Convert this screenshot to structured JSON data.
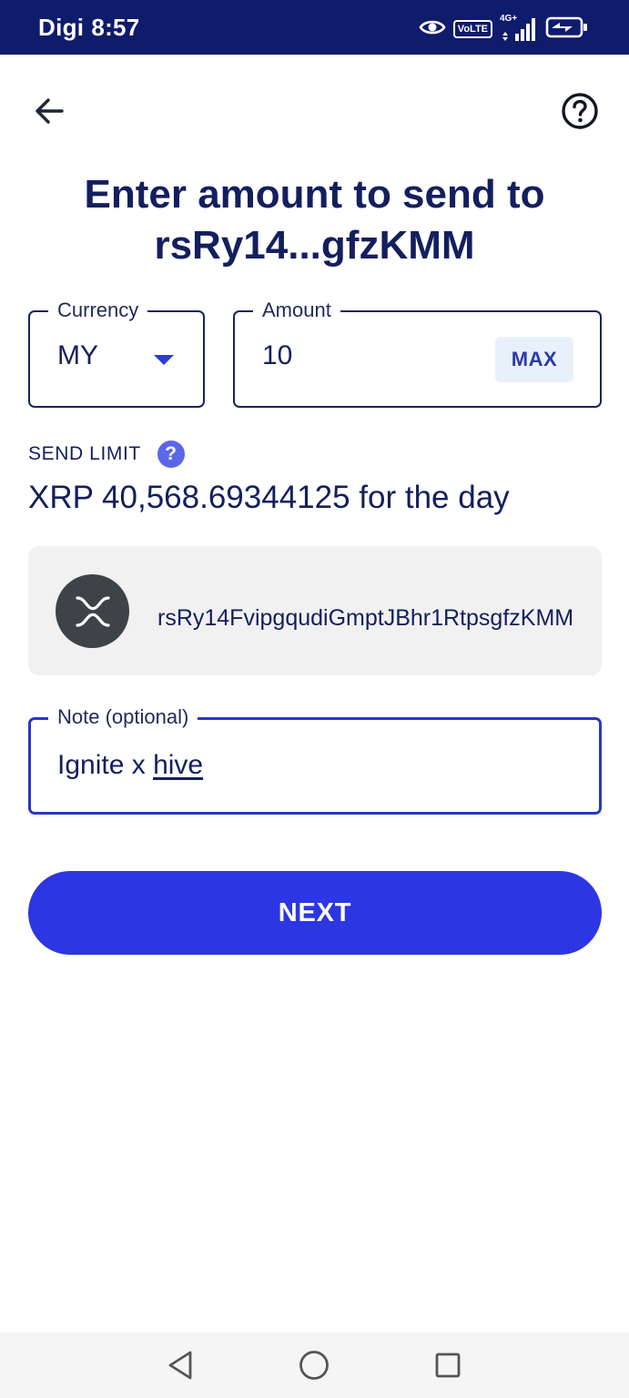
{
  "status_bar": {
    "carrier": "Digi",
    "time": "8:57",
    "volte": "VoLTE",
    "network": "4G+",
    "icons": [
      "eye-icon",
      "volte-icon",
      "signal-icon",
      "battery-charging-icon"
    ]
  },
  "header": {
    "back_icon": "arrow-left-icon",
    "help_icon": "question-circle-icon"
  },
  "title": {
    "line1": "Enter amount to send to",
    "line2": "rsRy14...gfzKMM"
  },
  "currency": {
    "label": "Currency",
    "value": "MY"
  },
  "amount": {
    "label": "Amount",
    "value": "10",
    "max_label": "MAX"
  },
  "send_limit": {
    "label": "SEND LIMIT",
    "help_glyph": "?",
    "value": "XRP 40,568.69344125 for the day"
  },
  "recipient": {
    "icon": "xrp-logo-icon",
    "address": "rsRy14FvipgqudiGmptJBhr1RtpsgfzKMM"
  },
  "note": {
    "label": "Note (optional)",
    "value_prefix": "Ignite x ",
    "value_underlined": "hive"
  },
  "actions": {
    "next_label": "NEXT"
  },
  "nav": {
    "icons": [
      "nav-back-icon",
      "nav-home-icon",
      "nav-recents-icon"
    ]
  },
  "colors": {
    "status_bar": "#0f1b6b",
    "primary": "#2c36e2",
    "text": "#131f5e",
    "max_bg": "#e8f0fc",
    "card_bg": "#f1f1f1",
    "help_badge": "#5a68e8"
  }
}
